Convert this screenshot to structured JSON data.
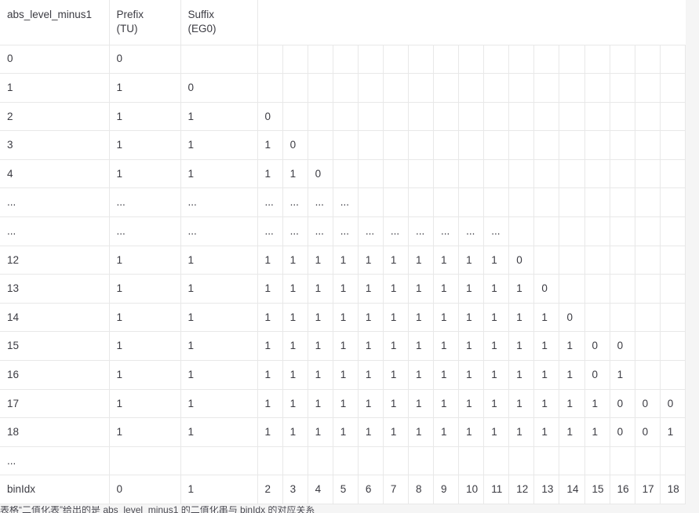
{
  "table": {
    "headers": {
      "col1": "abs_level_minus1",
      "col2_line1": "Prefix",
      "col2_line2": "(TU)",
      "col3_line1": "Suffix",
      "col3_line2": "(EG0)",
      "spanner": ""
    },
    "rows": [
      {
        "label": "0",
        "prefix": "0",
        "suffix": "",
        "bits": []
      },
      {
        "label": "1",
        "prefix": "1",
        "suffix": "0",
        "bits": []
      },
      {
        "label": "2",
        "prefix": "1",
        "suffix": "1",
        "bits": [
          "0"
        ]
      },
      {
        "label": "3",
        "prefix": "1",
        "suffix": "1",
        "bits": [
          "1",
          "0"
        ]
      },
      {
        "label": "4",
        "prefix": "1",
        "suffix": "1",
        "bits": [
          "1",
          "1",
          "0"
        ]
      },
      {
        "label": "...",
        "prefix": "...",
        "suffix": "...",
        "bits": [
          "...",
          "...",
          "...",
          "..."
        ]
      },
      {
        "label": "...",
        "prefix": "...",
        "suffix": "...",
        "bits": [
          "...",
          "...",
          "...",
          "...",
          "...",
          "...",
          "...",
          "...",
          "...",
          "..."
        ]
      },
      {
        "label": "12",
        "prefix": "1",
        "suffix": "1",
        "bits": [
          "1",
          "1",
          "1",
          "1",
          "1",
          "1",
          "1",
          "1",
          "1",
          "1",
          "0"
        ]
      },
      {
        "label": "13",
        "prefix": "1",
        "suffix": "1",
        "bits": [
          "1",
          "1",
          "1",
          "1",
          "1",
          "1",
          "1",
          "1",
          "1",
          "1",
          "1",
          "0"
        ]
      },
      {
        "label": "14",
        "prefix": "1",
        "suffix": "1",
        "bits": [
          "1",
          "1",
          "1",
          "1",
          "1",
          "1",
          "1",
          "1",
          "1",
          "1",
          "1",
          "1",
          "0"
        ]
      },
      {
        "label": "15",
        "prefix": "1",
        "suffix": "1",
        "bits": [
          "1",
          "1",
          "1",
          "1",
          "1",
          "1",
          "1",
          "1",
          "1",
          "1",
          "1",
          "1",
          "1",
          "0",
          "0"
        ]
      },
      {
        "label": "16",
        "prefix": "1",
        "suffix": "1",
        "bits": [
          "1",
          "1",
          "1",
          "1",
          "1",
          "1",
          "1",
          "1",
          "1",
          "1",
          "1",
          "1",
          "1",
          "0",
          "1"
        ]
      },
      {
        "label": "17",
        "prefix": "1",
        "suffix": "1",
        "bits": [
          "1",
          "1",
          "1",
          "1",
          "1",
          "1",
          "1",
          "1",
          "1",
          "1",
          "1",
          "1",
          "1",
          "1",
          "0",
          "0",
          "0"
        ]
      },
      {
        "label": "18",
        "prefix": "1",
        "suffix": "1",
        "bits": [
          "1",
          "1",
          "1",
          "1",
          "1",
          "1",
          "1",
          "1",
          "1",
          "1",
          "1",
          "1",
          "1",
          "1",
          "0",
          "0",
          "1"
        ]
      },
      {
        "label": "...",
        "prefix": "",
        "suffix": "",
        "bits": []
      },
      {
        "label": "binIdx",
        "prefix": "0",
        "suffix": "1",
        "bits": [
          "2",
          "3",
          "4",
          "5",
          "6",
          "7",
          "8",
          "9",
          "10",
          "11",
          "12",
          "13",
          "14",
          "15",
          "16",
          "17",
          "18"
        ]
      }
    ],
    "narrow_column_count": 17
  },
  "caption": {
    "text": "表格“二值化表”给出的是 abs_level_minus1 的二值化串与 binIdx 的对应关系"
  },
  "colors": {
    "text": "#3b3b42",
    "border": "#e8e8e8",
    "cell_background": "#ffffff",
    "page_background": "#f5f5f5"
  }
}
